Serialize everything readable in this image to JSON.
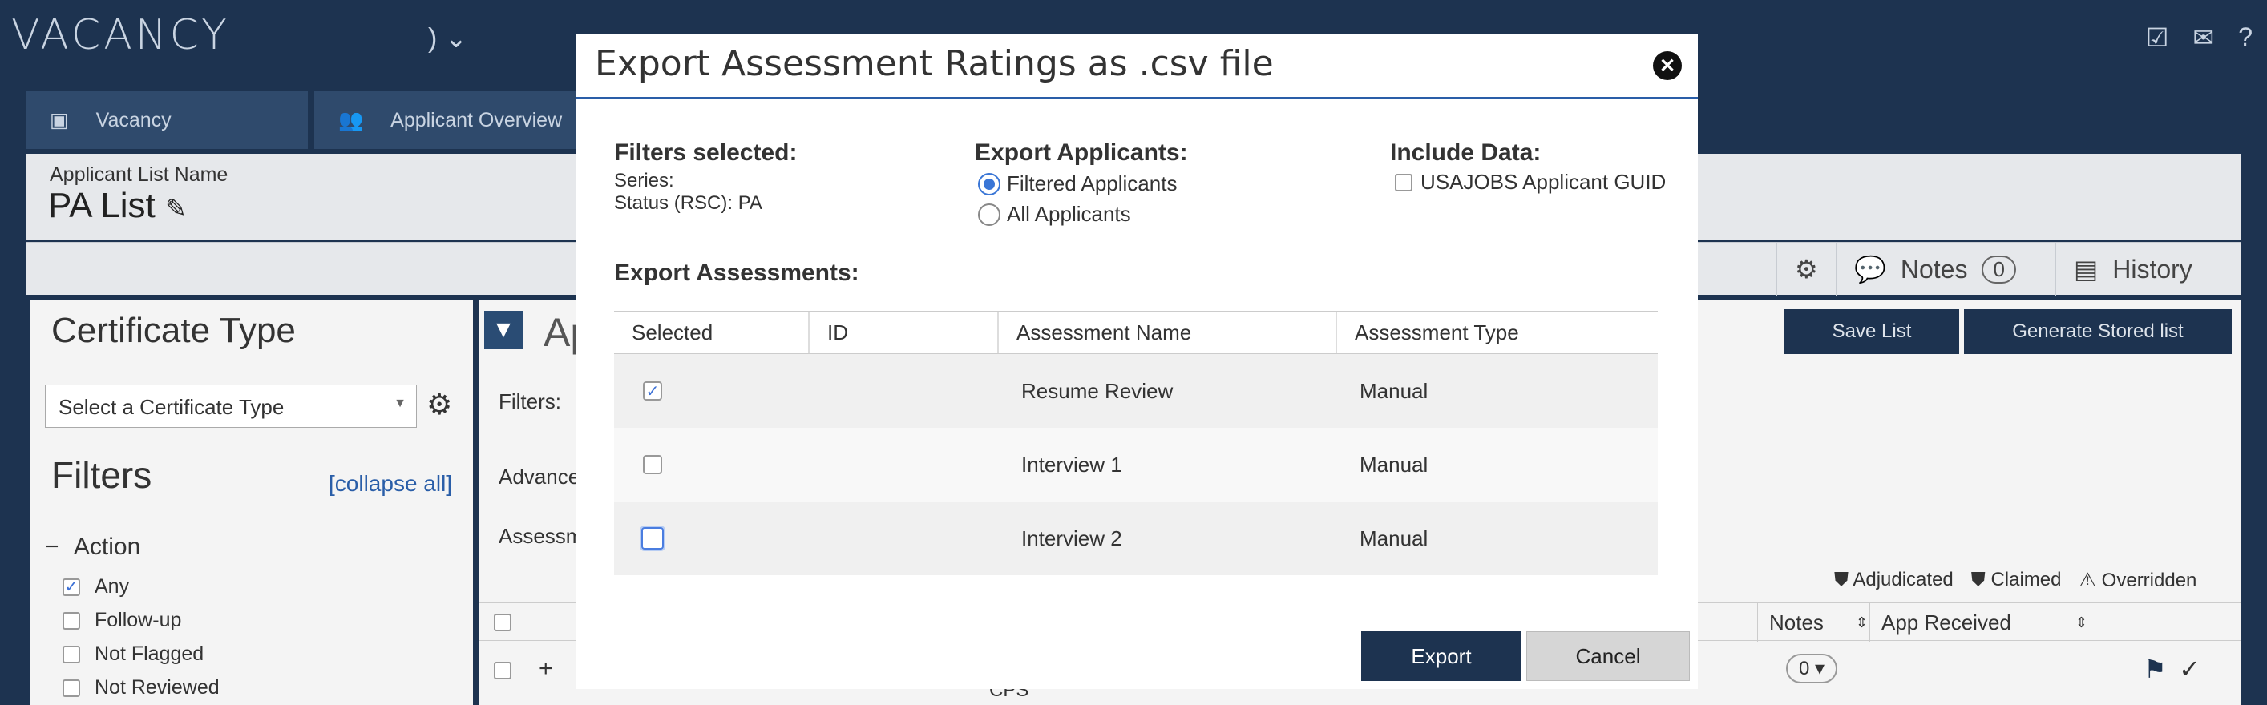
{
  "app": {
    "title": "VACANCY",
    "dropdown_glyph": ") ⌄",
    "top_icons": [
      "checklist-icon",
      "mail-icon",
      "help-icon"
    ]
  },
  "tabs": [
    {
      "label": "Vacancy",
      "icon": "briefcase-icon"
    },
    {
      "label": "Applicant Overview",
      "icon": "users-icon"
    }
  ],
  "list_header": {
    "label": "Applicant List Name",
    "value": "PA List",
    "toolbar": {
      "notes_label": "Notes",
      "notes_count": "0",
      "history_label": "History"
    }
  },
  "left_panel": {
    "cert_title": "Certificate Type",
    "cert_select": "Select a Certificate Type",
    "filters_title": "Filters",
    "collapse_all": "[collapse all]",
    "action_title": "Action",
    "action_items": [
      {
        "label": "Any",
        "checked": true
      },
      {
        "label": "Follow-up",
        "checked": false
      },
      {
        "label": "Not Flagged",
        "checked": false
      },
      {
        "label": "Not Reviewed",
        "checked": false
      }
    ]
  },
  "main_panel": {
    "heading": "Ap",
    "filters_label": "Filters:",
    "advanced_label": "Advance",
    "assess_label": "Assessm",
    "save_list": "Save List",
    "generate_stored": "Generate Stored list",
    "legend": [
      "Adjudicated",
      "Claimed",
      "Overridden"
    ],
    "table_headers": {
      "notes": "Notes",
      "app_received": "App Received"
    },
    "row": {
      "cps": "CPS",
      "notes_count": "0"
    }
  },
  "modal": {
    "title": "Export Assessment Ratings as .csv file",
    "filters_selected": {
      "title": "Filters selected:",
      "series": "Series:",
      "status": "Status (RSC): PA"
    },
    "export_applicants": {
      "title": "Export Applicants:",
      "options": [
        {
          "label": "Filtered Applicants",
          "selected": true
        },
        {
          "label": "All Applicants",
          "selected": false
        }
      ]
    },
    "include_data": {
      "title": "Include Data:",
      "option": "USAJOBS Applicant GUID",
      "checked": false
    },
    "export_assessments": {
      "title": "Export Assessments:",
      "columns": [
        "Selected",
        "ID",
        "Assessment Name",
        "Assessment Type"
      ],
      "rows": [
        {
          "selected": true,
          "id": "",
          "name": "Resume Review",
          "type": "Manual"
        },
        {
          "selected": false,
          "id": "",
          "name": "Interview 1",
          "type": "Manual"
        },
        {
          "selected": false,
          "id": "",
          "name": "Interview 2",
          "type": "Manual"
        }
      ]
    },
    "export_button": "Export",
    "cancel_button": "Cancel"
  }
}
